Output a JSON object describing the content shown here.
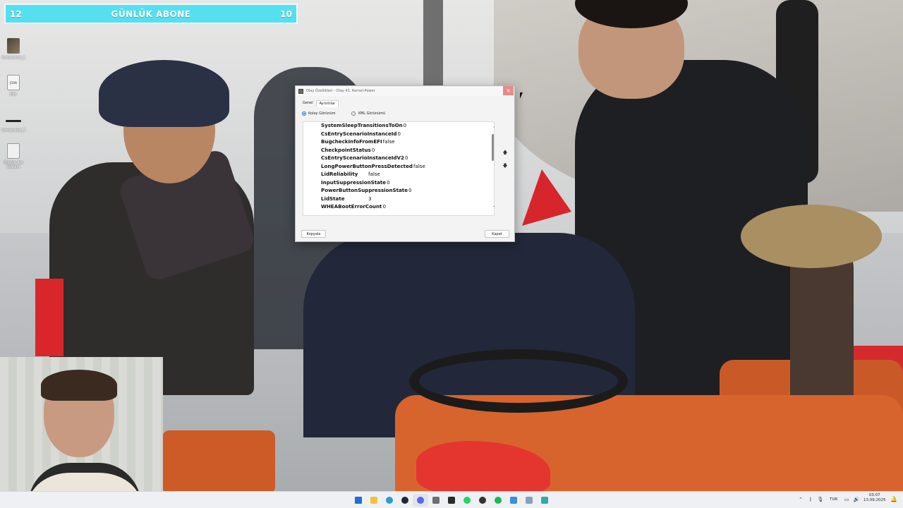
{
  "counter": {
    "left_number": "12",
    "title": "GÜNLÜK ABONE",
    "right_number": "10"
  },
  "desktop_icons": [
    {
      "label": "Screenshot_2",
      "icon": "photo-file-icon"
    },
    {
      "label": "Ekti",
      "icon": "json-file-icon",
      "badge": "JSON"
    },
    {
      "label": "Screenshot_3",
      "icon": "line-file-icon"
    },
    {
      "label": "Ölüdük Ark System",
      "icon": "document-file-icon"
    }
  ],
  "dialog": {
    "title": "Olay Özellikleri - Olay 41, Kernel-Power",
    "close_glyph": "✕",
    "tabs": [
      {
        "label": "Genel",
        "active": false
      },
      {
        "label": "Ayrıntılar",
        "active": true
      }
    ],
    "views": [
      {
        "label": "Kolay Görünüm",
        "selected": true
      },
      {
        "label": "XML Görünümü",
        "selected": false
      }
    ],
    "rows": [
      {
        "key": "SystemSleepTransitionsToOn",
        "value": "0"
      },
      {
        "key": "CsEntryScenarioInstanceId",
        "value": "0"
      },
      {
        "key": "BugcheckInfoFromEFI",
        "value": "false"
      },
      {
        "key": "CheckpointStatus",
        "value": "0"
      },
      {
        "key": "CsEntryScenarioInstanceIdV2",
        "value": "0"
      },
      {
        "key": "LongPowerButtonPressDetected",
        "value": "false"
      },
      {
        "key": "LidReliability",
        "value": "false"
      },
      {
        "key": "InputSuppressionState",
        "value": "0"
      },
      {
        "key": "PowerButtonSuppressionState",
        "value": "0"
      },
      {
        "key": "LidState",
        "value": "3"
      },
      {
        "key": "WHEABootErrorCount",
        "value": "0"
      }
    ],
    "copy_button": "Kopyala",
    "close_button": "Kapat"
  },
  "taskbar": {
    "apps": [
      {
        "name": "start-icon",
        "color": "#1f6fd6"
      },
      {
        "name": "file-explorer-icon",
        "color": "#f3c23c"
      },
      {
        "name": "edge-icon",
        "color": "#2f9ad6"
      },
      {
        "name": "steam-icon",
        "color": "#1b2838"
      },
      {
        "name": "discord-icon",
        "color": "#5865f2"
      },
      {
        "name": "settings-icon",
        "color": "#6e6e6e"
      },
      {
        "name": "epic-games-icon",
        "color": "#2a2a2a"
      },
      {
        "name": "whatsapp-icon",
        "color": "#25d366"
      },
      {
        "name": "chatgpt-icon",
        "color": "#333333"
      },
      {
        "name": "spotify-icon",
        "color": "#1db954"
      },
      {
        "name": "photos-icon",
        "color": "#3a8fd8"
      },
      {
        "name": "notepad-icon",
        "color": "#8aa0b8"
      },
      {
        "name": "document-icon",
        "color": "#33aaaa"
      }
    ],
    "tray": {
      "language": "TUR",
      "time": "03:07",
      "date": "13.09.2025"
    }
  }
}
